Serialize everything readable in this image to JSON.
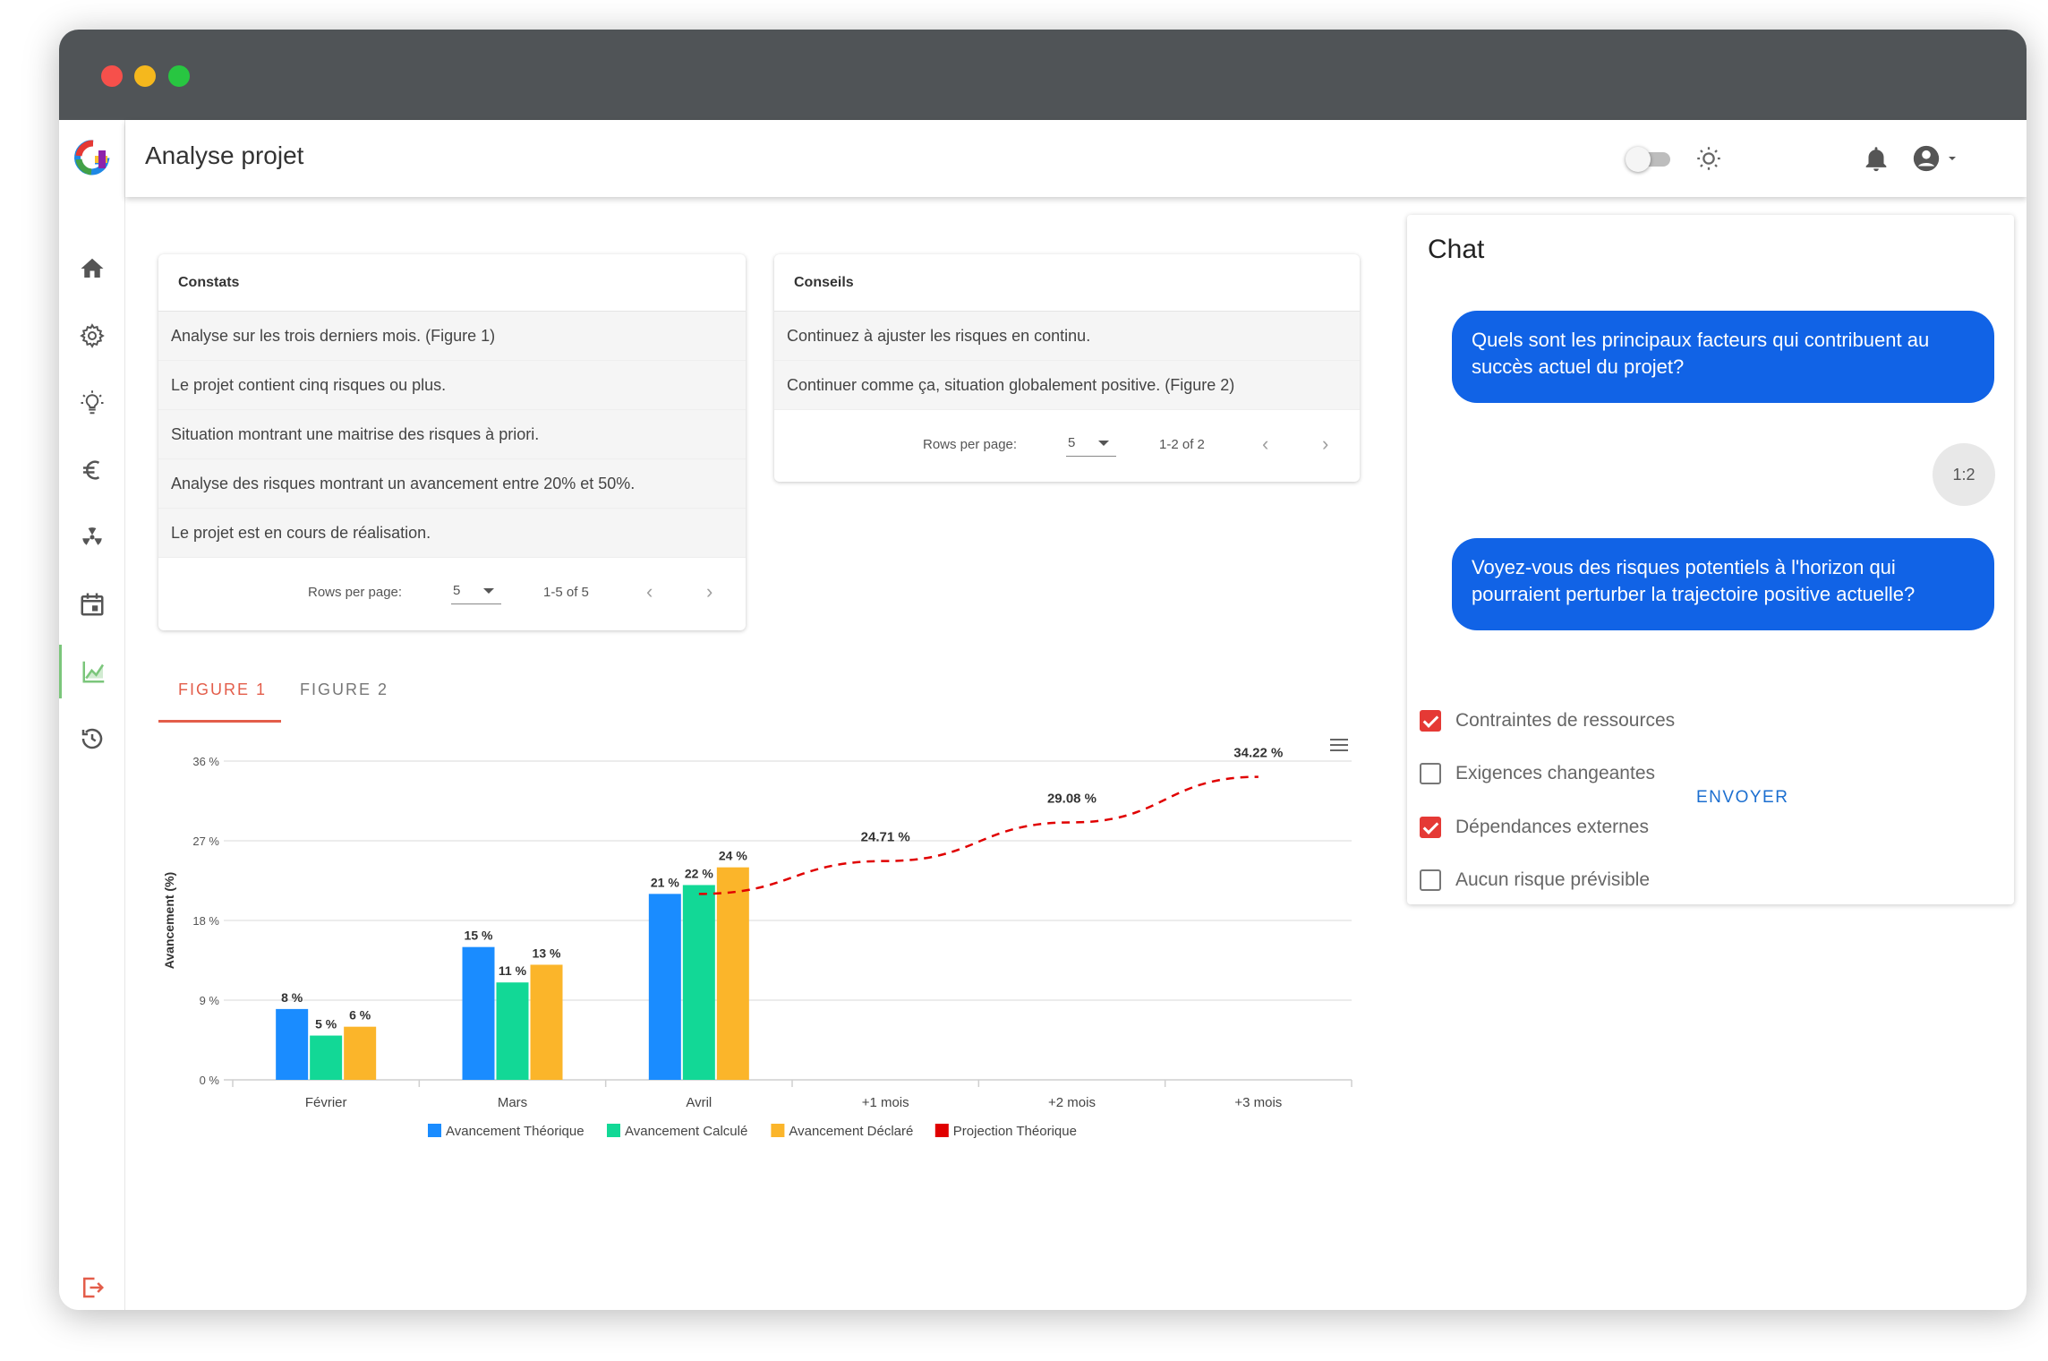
{
  "app": {
    "title": "Analyse projet"
  },
  "sidebar": {
    "items": [
      {
        "icon": "home-icon"
      },
      {
        "icon": "gear-icon"
      },
      {
        "icon": "lightbulb-icon"
      },
      {
        "icon": "euro-icon"
      },
      {
        "icon": "radiation-icon"
      },
      {
        "icon": "calendar-icon"
      },
      {
        "icon": "chart-icon",
        "active": true
      },
      {
        "icon": "history-icon"
      }
    ],
    "logout_icon": "logout-icon"
  },
  "constats": {
    "header": "Constats",
    "rows": [
      "Analyse sur les trois derniers mois. (Figure 1)",
      "Le projet contient cinq risques ou plus.",
      "Situation montrant une maitrise des risques à priori.",
      "Analyse des risques montrant un avancement entre 20% et 50%.",
      "Le projet est en cours de réalisation."
    ],
    "rows_per_page_label": "Rows per page:",
    "rows_per_page": "5",
    "range": "1-5 of 5"
  },
  "conseils": {
    "header": "Conseils",
    "rows": [
      "Continuez à ajuster les risques en continu.",
      "Continuer comme ça, situation globalement positive. (Figure 2)"
    ],
    "rows_per_page_label": "Rows per page:",
    "rows_per_page": "5",
    "range": "1-2 of 2"
  },
  "tabs": {
    "figure1": "FIGURE 1",
    "figure2": "FIGURE 2"
  },
  "chart_data": {
    "type": "bar",
    "categories": [
      "Février",
      "Mars",
      "Avril",
      "+1 mois",
      "+2 mois",
      "+3 mois"
    ],
    "ylabel": "Avancement (%)",
    "ylim": [
      0,
      36
    ],
    "yticks": [
      "0 %",
      "9 %",
      "18 %",
      "27 %",
      "36 %"
    ],
    "grid": true,
    "legend": "bottom",
    "series": [
      {
        "name": "Avancement Théorique",
        "color": "#1a8cff",
        "values": [
          8,
          15,
          21,
          null,
          null,
          null
        ],
        "labels": [
          "8 %",
          "15 %",
          "21 %"
        ]
      },
      {
        "name": "Avancement Calculé",
        "color": "#12d896",
        "values": [
          5,
          11,
          22,
          null,
          null,
          null
        ],
        "labels": [
          "5 %",
          "11 %",
          "22 %"
        ]
      },
      {
        "name": "Avancement Déclaré",
        "color": "#fbb52a",
        "values": [
          6,
          13,
          24,
          null,
          null,
          null
        ],
        "labels": [
          "6 %",
          "13 %",
          "24 %"
        ]
      },
      {
        "name": "Projection Théorique",
        "color": "#e00000",
        "type": "line",
        "values": [
          null,
          null,
          21,
          24.71,
          29.08,
          34.22
        ],
        "labels": [
          "",
          "",
          "",
          "24.71 %",
          "29.08 %",
          "34.22 %"
        ]
      }
    ]
  },
  "chat": {
    "title": "Chat",
    "messages": [
      "Quels sont les principaux facteurs qui contribuent au succès actuel du projet?",
      "Voyez-vous des risques potentiels à l'horizon qui pourraient perturber la trajectoire positive actuelle?"
    ],
    "badge": "1:2",
    "options": [
      {
        "label": "Contraintes de ressources",
        "checked": true
      },
      {
        "label": "Exigences changeantes",
        "checked": false
      },
      {
        "label": "Dépendances externes",
        "checked": true
      },
      {
        "label": "Aucun risque prévisible",
        "checked": false
      }
    ],
    "send_label": "ENVOYER"
  }
}
